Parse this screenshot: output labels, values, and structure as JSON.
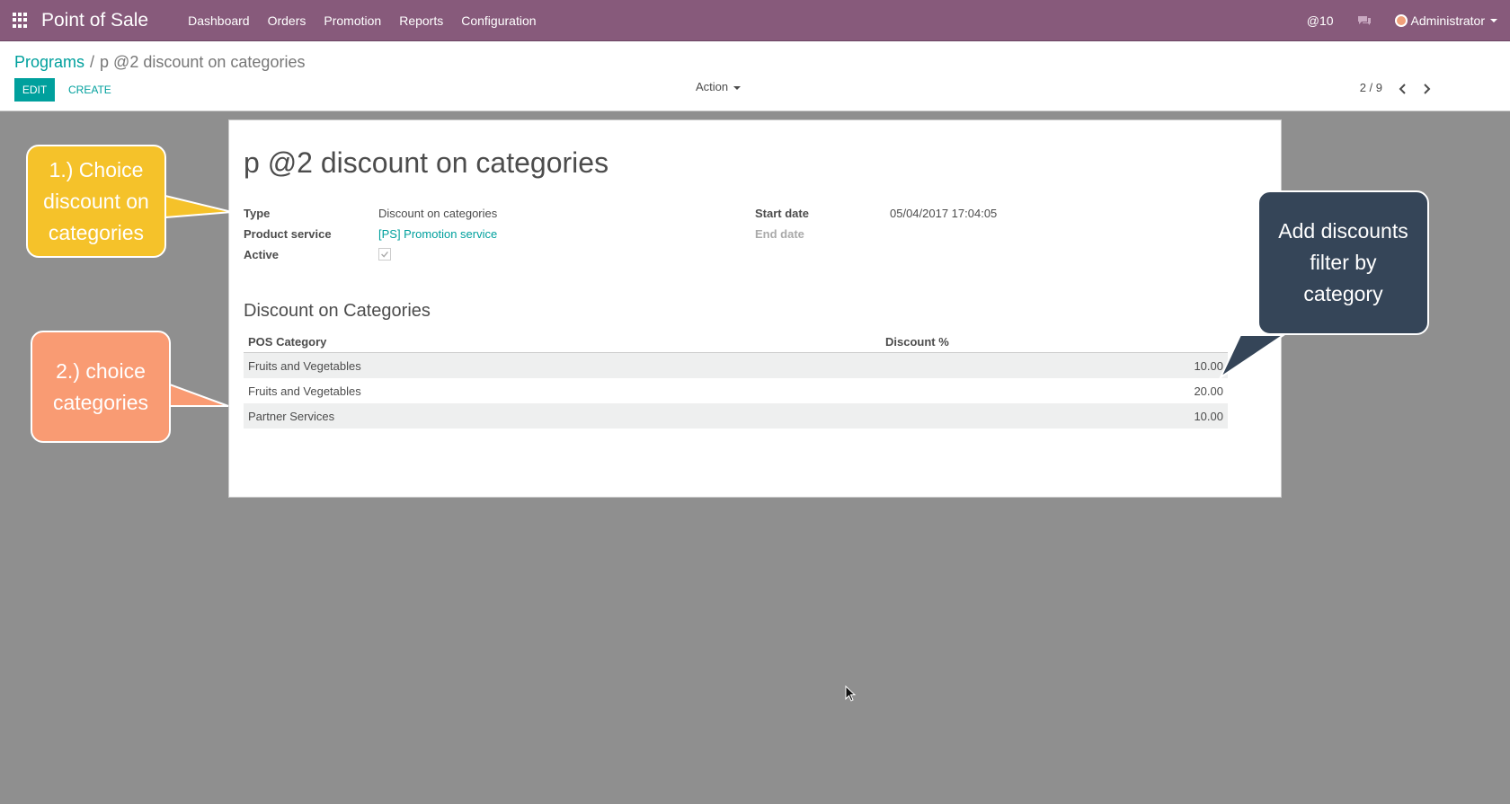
{
  "navbar": {
    "app_name": "Point of Sale",
    "menu": [
      "Dashboard",
      "Orders",
      "Promotion",
      "Reports",
      "Configuration"
    ],
    "notifications": "@10",
    "user": "Administrator"
  },
  "control": {
    "breadcrumb_parent": "Programs",
    "breadcrumb_sep": "/",
    "breadcrumb_current": "p @2 discount on categories",
    "edit_label": "EDIT",
    "create_label": "CREATE",
    "action_label": "Action",
    "pager": "2 / 9"
  },
  "form": {
    "title": "p @2 discount on categories",
    "type_label": "Type",
    "type_value": "Discount on categories",
    "product_label": "Product service",
    "product_value": "[PS] Promotion service",
    "active_label": "Active",
    "active": true,
    "start_label": "Start date",
    "start_value": "05/04/2017 17:04:05",
    "end_label": "End date",
    "section_title": "Discount on Categories",
    "columns": [
      "POS Category",
      "Discount %"
    ],
    "rows": [
      {
        "category": "Fruits and Vegetables",
        "discount": "10.00"
      },
      {
        "category": "Fruits and Vegetables",
        "discount": "20.00"
      },
      {
        "category": "Partner Services",
        "discount": "10.00"
      }
    ]
  },
  "callouts": {
    "c1": [
      "1.) Choice",
      "discount on",
      "categories"
    ],
    "c2": [
      "2.) choice",
      "categories"
    ],
    "c3": [
      "Add discounts",
      "filter by",
      "category"
    ]
  },
  "colors": {
    "navbar": "#875a7b",
    "accent": "#00a09d",
    "callout_yellow": "#f5c22a",
    "callout_orange": "#f99b73",
    "callout_dark": "#354558"
  }
}
